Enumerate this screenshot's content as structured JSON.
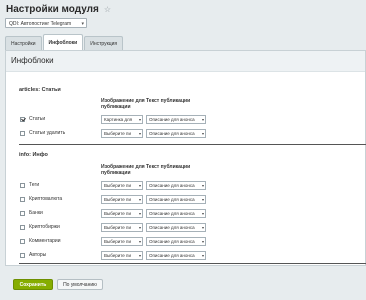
{
  "page": {
    "title": "Настройки модуля"
  },
  "module_select": {
    "value": "QDI: Автопостинг Telegram"
  },
  "tabs": [
    {
      "label": "Настройки"
    },
    {
      "label": "Инфоблоки"
    },
    {
      "label": "Инструкция"
    }
  ],
  "panel": {
    "title": "Инфоблоки"
  },
  "columns": {
    "image": "Изображение для публикации",
    "text": "Текст публикации"
  },
  "sections": [
    {
      "title": "articles: Статьи",
      "rows": [
        {
          "label": "Статьи",
          "checked": true,
          "image": "Картинка для",
          "text": "Описание для анонса"
        },
        {
          "label": "Статьи удалить",
          "checked": false,
          "image": "Выберите пи",
          "text": "Описание для анонса"
        }
      ]
    },
    {
      "title": "info: Инфо",
      "rows": [
        {
          "label": "Теги",
          "checked": false,
          "image": "Выберите пи",
          "text": "Описание для анонса"
        },
        {
          "label": "Криптовалюта",
          "checked": false,
          "image": "Выберите пи",
          "text": "Описание для анонса"
        },
        {
          "label": "Банки",
          "checked": false,
          "image": "Выберите пи",
          "text": "Описание для анонса"
        },
        {
          "label": "Криптобиржи",
          "checked": false,
          "image": "Выберите пи",
          "text": "Описание для анонса"
        },
        {
          "label": "Комментарии",
          "checked": false,
          "image": "Выберите пи",
          "text": "Описание для анонса"
        },
        {
          "label": "Авторы",
          "checked": false,
          "image": "Выберите пи",
          "text": "Описание для анонса"
        }
      ]
    }
  ],
  "footer": {
    "save_label": "Сохранить",
    "default_label": "По умолчанию"
  },
  "icons": {
    "star": "star-icon",
    "dropdown": "chevron-down-icon"
  },
  "colors": {
    "save_button": "#86ad00",
    "background": "#e7ecee"
  }
}
